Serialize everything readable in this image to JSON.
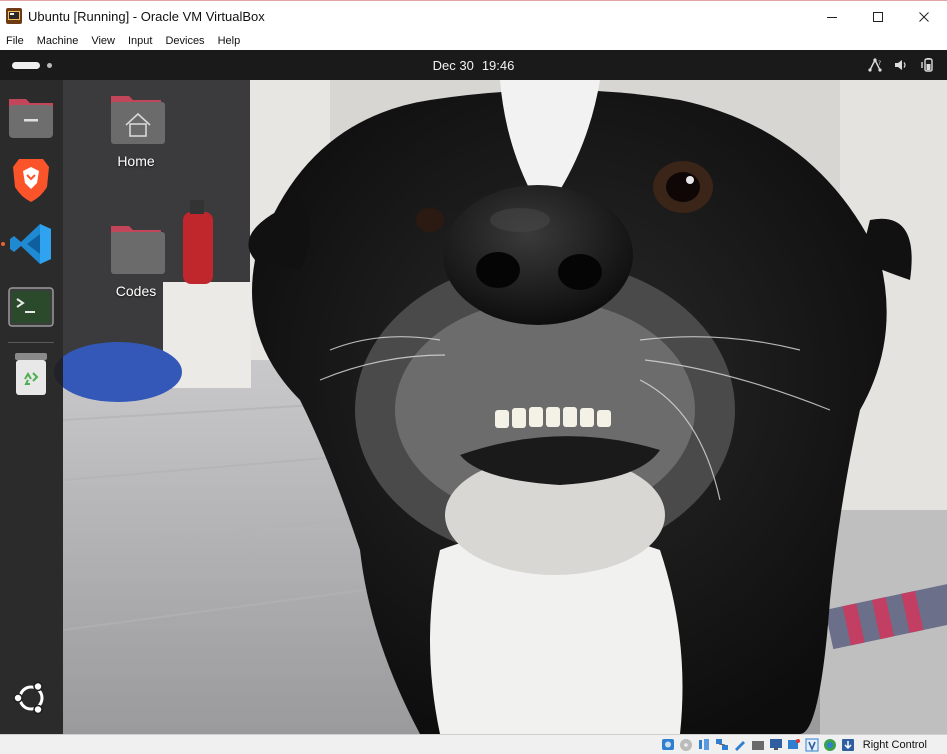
{
  "window": {
    "title": "Ubuntu [Running] - Oracle VM VirtualBox"
  },
  "menubar": {
    "items": [
      "File",
      "Machine",
      "View",
      "Input",
      "Devices",
      "Help"
    ]
  },
  "topbar": {
    "date": "Dec 30",
    "time": "19:46"
  },
  "dock": {
    "items": [
      {
        "name": "Files",
        "icon": "files-icon"
      },
      {
        "name": "Brave",
        "icon": "brave-icon"
      },
      {
        "name": "Visual Studio Code",
        "icon": "vscode-icon",
        "running": true
      },
      {
        "name": "Terminal",
        "icon": "terminal-icon"
      },
      {
        "name": "Trash",
        "icon": "trash-icon"
      },
      {
        "name": "Show Applications",
        "icon": "ubuntu-apps-icon"
      }
    ]
  },
  "desktop": {
    "icons": [
      {
        "label": "Home",
        "icon": "home-folder-icon"
      },
      {
        "label": "Codes",
        "icon": "folder-icon"
      }
    ]
  },
  "statusbar": {
    "host_key": "Right Control"
  },
  "colors": {
    "accent": "#e9622f",
    "topbar": "#1a1a1a",
    "folder": "#6b6b6b",
    "folder_tab": "#c2455a"
  }
}
